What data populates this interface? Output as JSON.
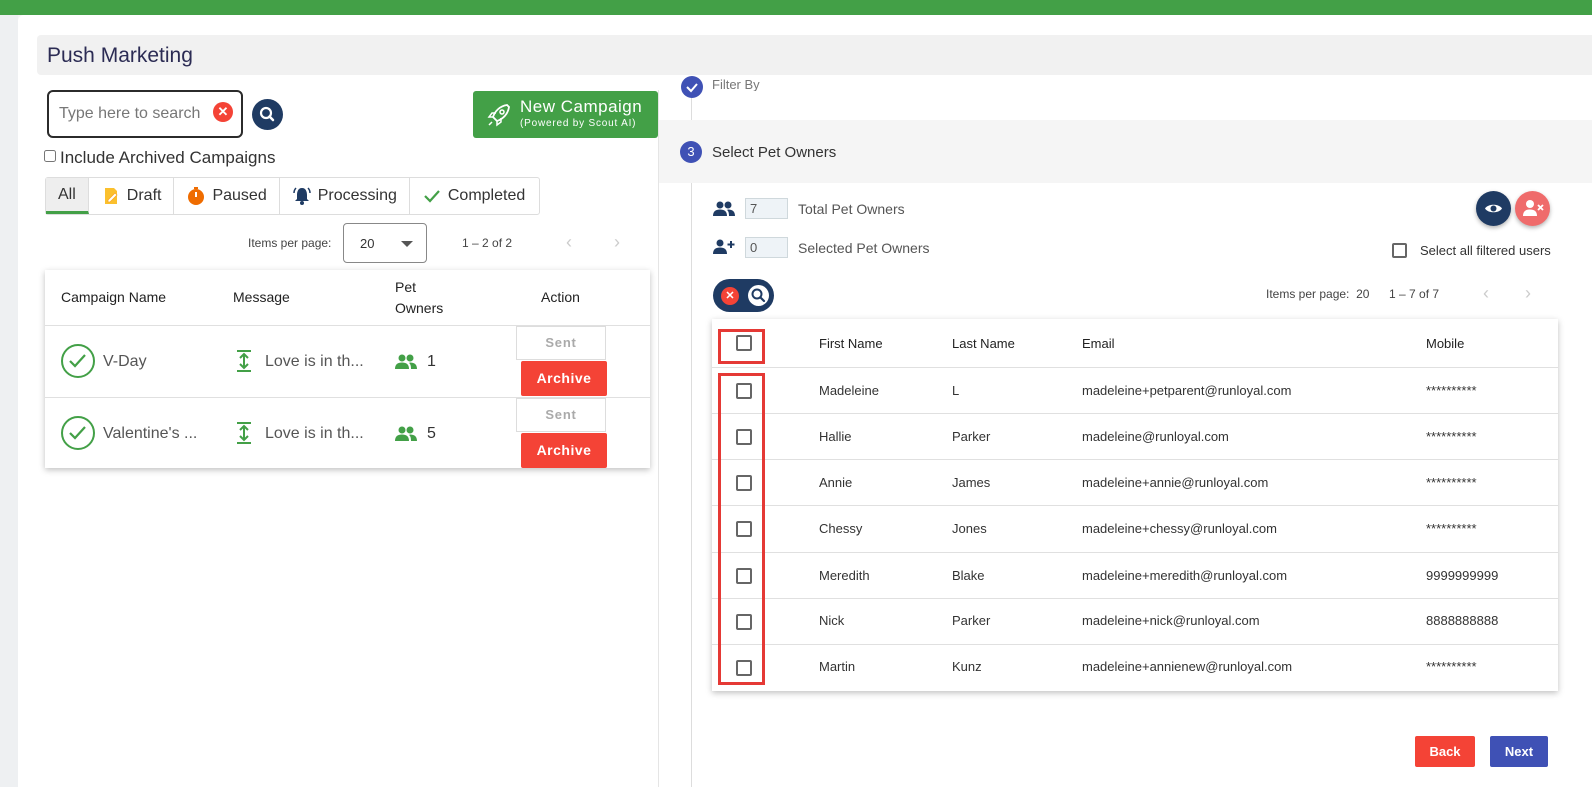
{
  "header": {
    "title": "Push Marketing"
  },
  "search": {
    "placeholder": "Type here to search"
  },
  "new_campaign": {
    "title": "New Campaign",
    "subtitle": "(Powered by Scout AI)"
  },
  "archived": {
    "label": "Include Archived Campaigns",
    "checked": false
  },
  "tabs": [
    {
      "label": "All",
      "icon": "none",
      "active": true
    },
    {
      "label": "Draft",
      "icon": "draft-icon"
    },
    {
      "label": "Paused",
      "icon": "timer-icon"
    },
    {
      "label": "Processing",
      "icon": "bell-icon"
    },
    {
      "label": "Completed",
      "icon": "check-icon"
    }
  ],
  "left_pagination": {
    "items_per_page_label": "Items per page:",
    "items_per_page": "20",
    "range": "1 – 2 of 2"
  },
  "campaigns": {
    "headers": {
      "name": "Campaign Name",
      "message": "Message",
      "pet_owners_1": "Pet",
      "pet_owners_2": "Owners",
      "action": "Action"
    },
    "rows": [
      {
        "name": "V-Day",
        "message": "Love is in th...",
        "pet_owners": "1",
        "status": "Sent",
        "archive": "Archive"
      },
      {
        "name": "Valentine's ...",
        "message": "Love is in th...",
        "pet_owners": "5",
        "status": "Sent",
        "archive": "Archive"
      }
    ]
  },
  "steps": {
    "prev_label": "Filter By",
    "current_number": "3",
    "current_label": "Select Pet Owners"
  },
  "stats": {
    "total_value": "7",
    "total_label": "Total Pet Owners",
    "selected_value": "0",
    "selected_label": "Selected Pet Owners"
  },
  "select_all": {
    "label": "Select all filtered users",
    "checked": false
  },
  "right_pagination": {
    "items_per_page_label": "Items per page:",
    "items_per_page": "20",
    "range": "1 – 7 of 7"
  },
  "owners": {
    "headers": {
      "first": "First Name",
      "last": "Last Name",
      "email": "Email",
      "mobile": "Mobile"
    },
    "rows": [
      {
        "first": "Madeleine",
        "last": "L",
        "email": "madeleine+petparent@runloyal.com",
        "mobile": "**********"
      },
      {
        "first": "Hallie",
        "last": "Parker",
        "email": "madeleine@runloyal.com",
        "mobile": "**********"
      },
      {
        "first": "Annie",
        "last": "James",
        "email": "madeleine+annie@runloyal.com",
        "mobile": "**********"
      },
      {
        "first": "Chessy",
        "last": "Jones",
        "email": "madeleine+chessy@runloyal.com",
        "mobile": "**********"
      },
      {
        "first": "Meredith",
        "last": "Blake",
        "email": "madeleine+meredith@runloyal.com",
        "mobile": "9999999999"
      },
      {
        "first": "Nick",
        "last": "Parker",
        "email": "madeleine+nick@runloyal.com",
        "mobile": "8888888888"
      },
      {
        "first": "Martin",
        "last": "Kunz",
        "email": "madeleine+annienew@runloyal.com",
        "mobile": "**********"
      }
    ]
  },
  "footer": {
    "back": "Back",
    "next": "Next"
  },
  "colors": {
    "brand_green": "#43a047",
    "primary_blue": "#3f51b5",
    "danger_red": "#f44336",
    "navy": "#1f3b63"
  }
}
